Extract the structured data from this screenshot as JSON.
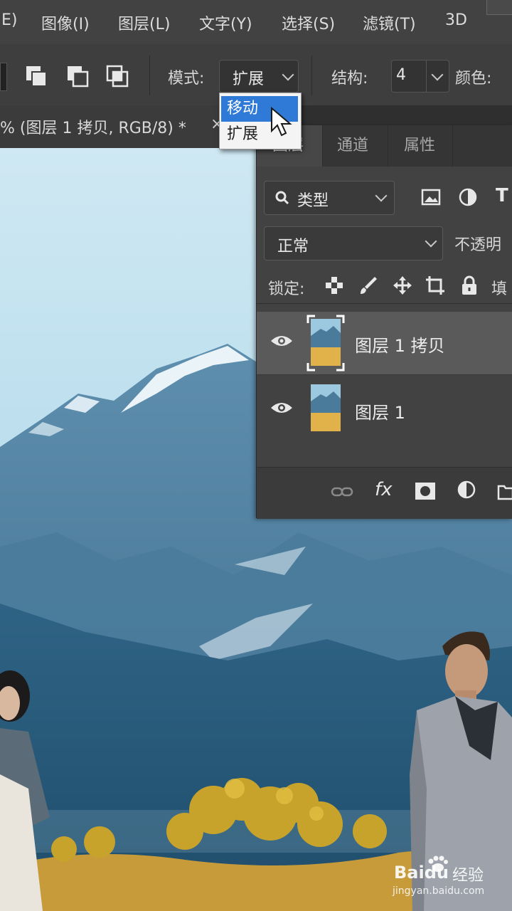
{
  "menubar": {
    "items": [
      {
        "label": "E)"
      },
      {
        "label": "图像(I)"
      },
      {
        "label": "图层(L)"
      },
      {
        "label": "文字(Y)"
      },
      {
        "label": "选择(S)"
      },
      {
        "label": "滤镜(T)"
      },
      {
        "label": "3D"
      }
    ]
  },
  "options": {
    "mode_label": "模式:",
    "mode_value": "扩展",
    "structure_label": "结构:",
    "structure_value": "4",
    "color_label": "颜色:"
  },
  "dropdown": {
    "items": [
      {
        "label": "移动",
        "highlighted": true
      },
      {
        "label": "扩展",
        "highlighted": false
      }
    ]
  },
  "document": {
    "tab_title": "% (图层 1 拷贝, RGB/8) *",
    "close_glyph": "×"
  },
  "layers_panel": {
    "tabs": [
      {
        "label": "图层",
        "active": true
      },
      {
        "label": "通道",
        "active": false
      },
      {
        "label": "属性",
        "active": false
      }
    ],
    "filter_kind": "类型",
    "blend_mode": "正常",
    "opacity_label": "不透明",
    "lock_label": "锁定:",
    "fill_label": "填",
    "layers": [
      {
        "name": "图层 1 拷贝",
        "visible": true,
        "selected": true
      },
      {
        "name": "图层 1",
        "visible": true,
        "selected": false
      }
    ],
    "footer_fx": "fx"
  },
  "watermark": {
    "brand": "Baidu",
    "brand_cn": "经验",
    "url": "jingyan.baidu.com"
  },
  "colors": {
    "menubar": "#424242",
    "panel": "#424242",
    "dropdown_highlight": "#2f7ad6",
    "selected_layer": "#5a5a5a"
  }
}
